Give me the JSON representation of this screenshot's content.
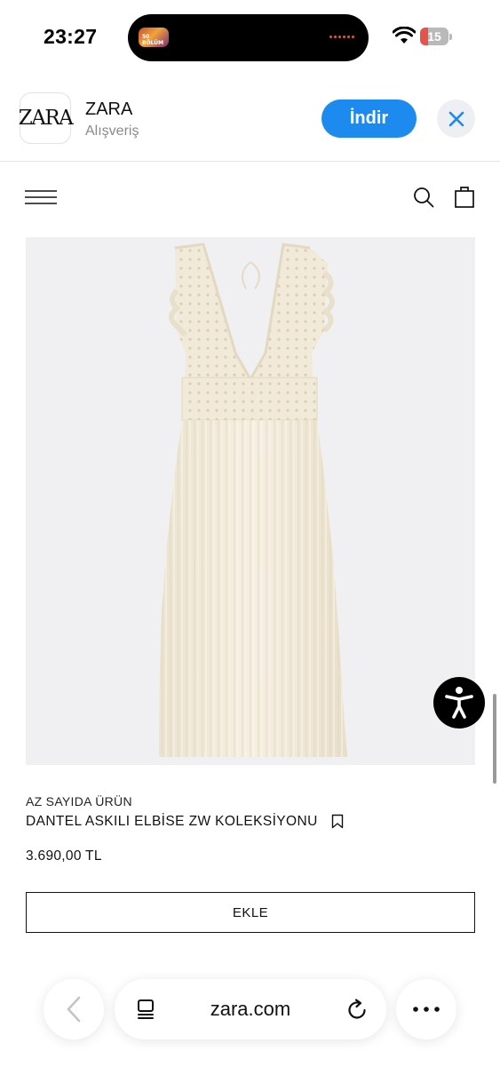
{
  "status_bar": {
    "time": "23:27",
    "island_thumbnail_label": "50 BÖLÜM",
    "battery": "15"
  },
  "app_banner": {
    "icon_text": "ZARA",
    "name": "ZARA",
    "category": "Alışveriş",
    "install_label": "İndir"
  },
  "product": {
    "stock_note": "AZ SAYIDA ÜRÜN",
    "name": "DANTEL ASKILI ELBİSE ZW KOLEKSİYONU",
    "price": "3.690,00 TL",
    "add_label": "EKLE"
  },
  "browser": {
    "url": "zara.com"
  },
  "colors": {
    "install_button": "#1d8af0",
    "product_background": "#f0f0f2",
    "dress": "#f2ecdc"
  },
  "icons": {
    "menu": "hamburger-icon",
    "search": "search-icon",
    "bag": "shopping-bag-icon",
    "bookmark": "bookmark-icon",
    "accessibility": "accessibility-icon"
  }
}
